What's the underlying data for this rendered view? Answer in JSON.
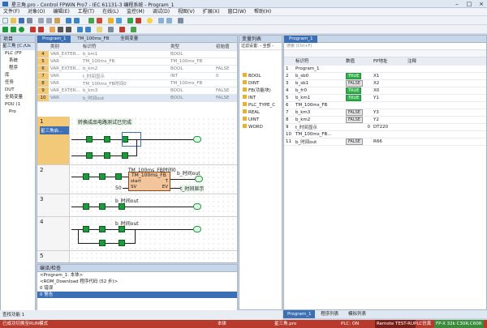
{
  "title": "星三角.pro - Control FPWIN Pro7 - IEC 61131-3 编程系统 - Program_1",
  "menu": [
    "文件(F)",
    "对象(O)",
    "编辑(E)",
    "工程(T)",
    "在线(L)",
    "监控(M)",
    "调试(D)",
    "视图(V)",
    "扩展(X)",
    "窗口(W)",
    "帮助(H)"
  ],
  "project": {
    "header": "项目",
    "items": [
      "星三角 [C:/Us",
      "PLC (FP",
      "系统",
      "程序",
      "库",
      "任务",
      "DUT",
      "全局变量",
      "POU (1",
      "Pro"
    ]
  },
  "program_tabs": [
    "Program_1",
    "TM_100ms_FB",
    "全局变量"
  ],
  "var_table": {
    "headers": [
      "类别",
      "标识符",
      "类型",
      "初始值"
    ],
    "rows": [
      {
        "n": "4",
        "cat": "VAR_EXTER...",
        "id": "b_km1",
        "type": "BOOL",
        "init": ""
      },
      {
        "n": "5",
        "cat": "VAR",
        "id": "TM_100ms_FB",
        "type": "TM_100ms_FB",
        "init": ""
      },
      {
        "n": "6",
        "cat": "VAR_EXTER...",
        "id": "b_km2",
        "type": "BOOL",
        "init": "FALSE"
      },
      {
        "n": "7",
        "cat": "VAR",
        "id": "t_时间显示",
        "type": "INT",
        "init": "0"
      },
      {
        "n": "8",
        "cat": "VAR",
        "id": "TM_100ms_FB时间0",
        "type": "TM_100ms_FB",
        "init": ""
      },
      {
        "n": "9",
        "cat": "VAR_EXTER...",
        "id": "b_km3",
        "type": "BOOL",
        "init": "FALSE"
      },
      {
        "n": "10",
        "cat": "VAR",
        "id": "b_时间out",
        "type": "BOOL",
        "init": "FALSE"
      }
    ]
  },
  "ladder": {
    "rungs": [
      {
        "num": "1",
        "label": "星三角启...",
        "comment": "转换成品电路测试已完成"
      },
      {
        "num": "2",
        "fb_title": "TM_100ms_FB时间0",
        "fb_name": "TM_100ms_FB",
        "fb_in1": "start",
        "fb_in2": "SV",
        "fb_out1": "T",
        "fb_out2": "EV",
        "sv": "50",
        "coil": "b_时间out",
        "ev": "t_时间显示"
      },
      {
        "num": "3",
        "contact": "b_时间out"
      },
      {
        "num": "4",
        "contact": "b_时间out"
      },
      {
        "num": "5"
      }
    ]
  },
  "output": {
    "header": "编译/检查",
    "lines": [
      "<Program_1: 本体>",
      "<ROM_Download 程序代码 (52 步)>",
      "0 错误",
      "0 警告"
    ]
  },
  "types": {
    "header": "变量列表",
    "filter": "过滤设置: - 全部 -",
    "items": [
      "BOOL",
      "DINT",
      "FB(功能块)",
      "INT",
      "PLC_TYPE_C",
      "REAL",
      "UINT",
      "WORD"
    ]
  },
  "monitor": {
    "tab": "Program_1",
    "search": "搜索 (Ctrl+F)",
    "headers": [
      "",
      "标识符",
      "数值",
      "FP地址",
      "注释"
    ],
    "rows": [
      {
        "n": "1",
        "id": "Program_1",
        "val": "",
        "addr": ""
      },
      {
        "n": "2",
        "id": "b_sb0",
        "val": "TRUE",
        "addr": "X1"
      },
      {
        "n": "3",
        "id": "b_sb1",
        "val": "FALSE",
        "addr": "X2"
      },
      {
        "n": "4",
        "id": "b_fr0",
        "val": "TRUE",
        "addr": "X0"
      },
      {
        "n": "5",
        "id": "b_km1",
        "val": "TRUE",
        "addr": "Y1"
      },
      {
        "n": "6",
        "id": "TM_100ms_FB",
        "val": "",
        "addr": ""
      },
      {
        "n": "7",
        "id": "b_km3",
        "val": "FALSE",
        "addr": "Y3"
      },
      {
        "n": "8",
        "id": "b_km2",
        "val": "FALSE",
        "addr": "Y2"
      },
      {
        "n": "9",
        "id": "t_时间显示",
        "val": "0",
        "addr": "DT220"
      },
      {
        "n": "10",
        "id": "TM_100ms_FB...",
        "val": "",
        "addr": ""
      },
      {
        "n": "11",
        "id": "b_时间out",
        "val": "FALSE",
        "addr": "R66"
      }
    ],
    "bottom_tabs": [
      "Program_1",
      "程序列表",
      "模拟列表"
    ]
  },
  "status": {
    "left": "查找功能 1",
    "msg": "已成功切换至RUN模式",
    "c1": "本体",
    "c2": "星三角.pro",
    "c3": "PLC: ON",
    "c4": "Remote TEST-RU",
    "c5": "PLC仿真",
    "c6": "FP-X 32k C30R,C60R"
  }
}
